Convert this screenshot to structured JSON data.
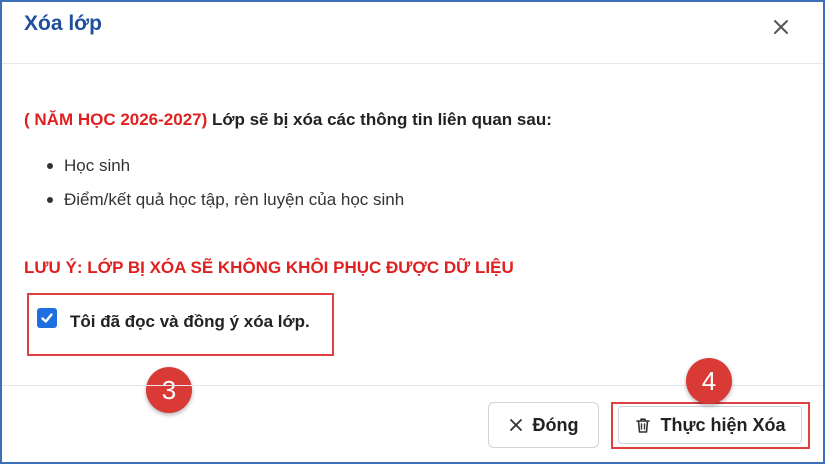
{
  "dialog": {
    "title": "Xóa lớp",
    "close_icon": "close-icon"
  },
  "content": {
    "year_label": "( NĂM HỌC 2026-2027)",
    "warning_text": "Lớp sẽ bị xóa các thông tin liên quan sau:",
    "items": [
      "Học sinh",
      "Điểm/kết quả học tập, rèn luyện của học sinh"
    ],
    "note": "LƯU Ý: LỚP BỊ XÓA SẼ KHÔNG KHÔI PHỤC ĐƯỢC DỮ LIỆU",
    "agree": {
      "label": "Tôi đã đọc và đồng ý xóa lớp.",
      "checked": true
    }
  },
  "annotations": {
    "step_3": "3",
    "step_4": "4"
  },
  "footer": {
    "close_button_label": "Đóng",
    "close_button_icon": "x-icon",
    "delete_button_label": "Thực hiện Xóa",
    "delete_button_icon": "trash-icon"
  },
  "colors": {
    "title": "#1f4f9e",
    "warning_red": "#e02020",
    "checkbox_blue": "#1f6fe0",
    "highlight_red": "#e04040",
    "badge_red": "#d93a35",
    "dialog_border": "#3b6fb6"
  }
}
